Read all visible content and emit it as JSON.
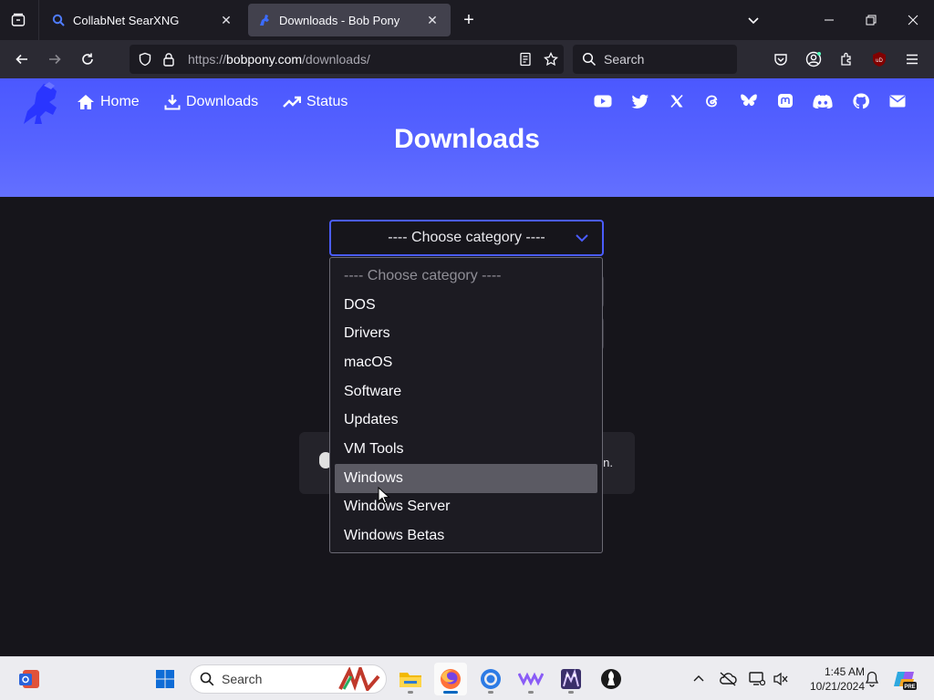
{
  "browser": {
    "tabs": [
      {
        "title": "CollabNet SearXNG",
        "active": false
      },
      {
        "title": "Downloads - Bob Pony",
        "active": true
      }
    ],
    "url_prefix": "https://",
    "url_host": "bobpony.com",
    "url_path": "/downloads/",
    "search_placeholder": "Search",
    "extension_badge": "uD"
  },
  "site": {
    "nav": [
      {
        "label": "Home",
        "icon": "home-icon"
      },
      {
        "label": "Downloads",
        "icon": "download-icon"
      },
      {
        "label": "Status",
        "icon": "trending-up-icon"
      }
    ],
    "social_icons": [
      "youtube-icon",
      "twitter-icon",
      "x-icon",
      "threads-icon",
      "bluesky-icon",
      "mastodon-icon",
      "discord-icon",
      "github-icon",
      "email-icon"
    ],
    "page_title": "Downloads",
    "accent_color": "#5463ff"
  },
  "category_select": {
    "selected": "---- Choose category ----",
    "options": [
      "---- Choose category ----",
      "DOS",
      "Drivers",
      "macOS",
      "Software",
      "Updates",
      "VM Tools",
      "Windows",
      "Windows Server",
      "Windows Betas"
    ],
    "highlighted_option": "Windows"
  },
  "background_card": {
    "visible_text_fragment": "n."
  },
  "taskbar": {
    "search_label": "Search",
    "time": "1:45 AM",
    "date": "10/21/2024",
    "apps": [
      "app-icon",
      "windows-start-icon",
      "file-explorer-icon",
      "firefox-icon",
      "chrome-icon",
      "app-icon",
      "app-icon",
      "app-icon"
    ]
  }
}
